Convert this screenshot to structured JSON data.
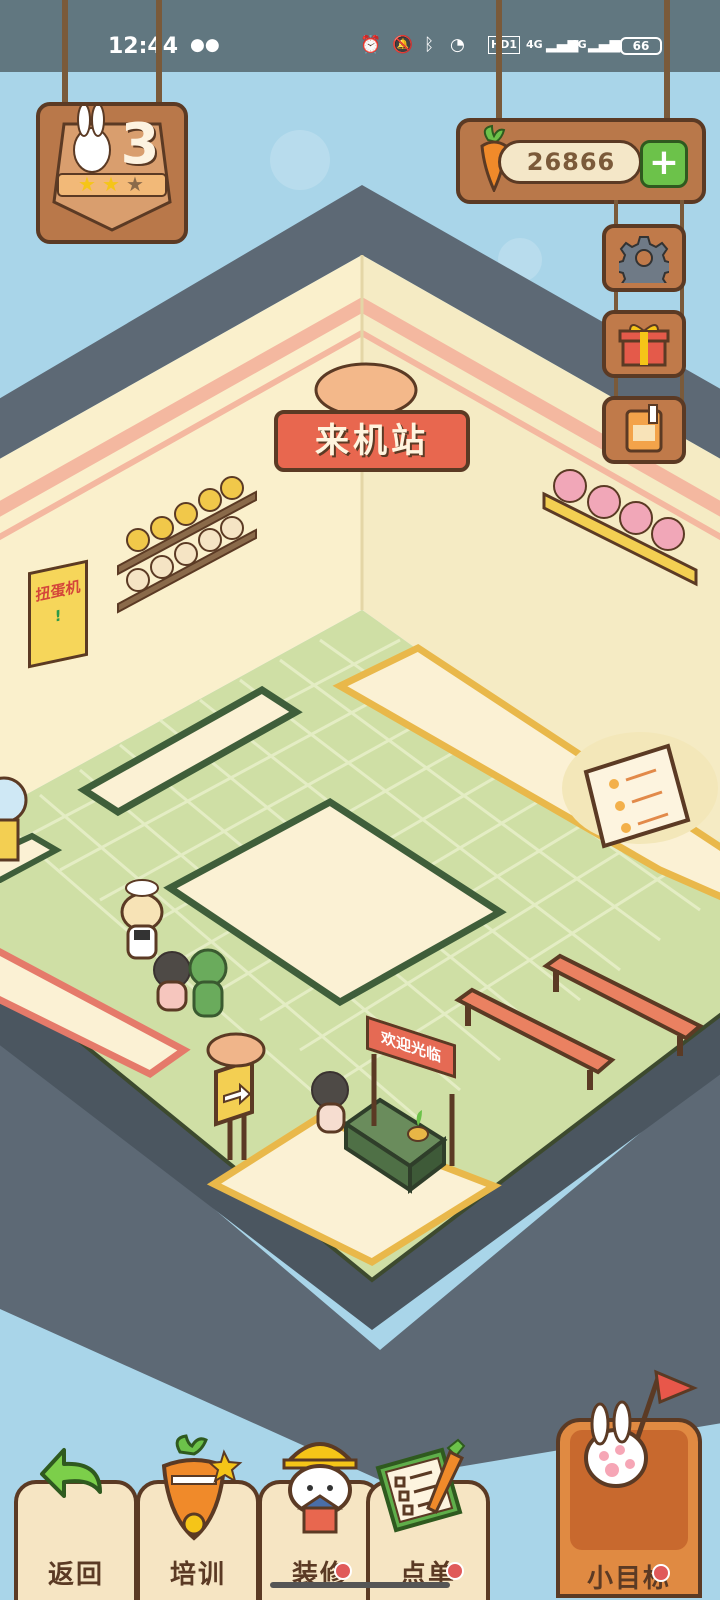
{
  "status_bar": {
    "time": "12:44",
    "icons": [
      "wechat-icon",
      "alarm-icon",
      "mute-icon",
      "bluetooth-icon",
      "wifi-icon",
      "hd-icon",
      "signal-4g-icon",
      "signal-4g-icon"
    ],
    "hd_label": "HD1",
    "net1": "4G",
    "net2": "4G",
    "battery": "66"
  },
  "hud": {
    "level": "3",
    "stars_filled": 2,
    "stars_total": 3,
    "carrots": "26866",
    "add_label": "+"
  },
  "scene": {
    "shop_sign": "来机站",
    "poster_line1": "扭蛋机",
    "poster_line2": "!",
    "welcome_sign": "欢迎光临"
  },
  "side_buttons": [
    "gear-icon",
    "gift-icon",
    "renovation-book-icon"
  ],
  "bottom_nav": {
    "back": "返回",
    "train": "培训",
    "renovate": "装修",
    "order": "点单",
    "goal": "小目标"
  },
  "colors": {
    "sky": "#a9d5e9",
    "floor": "#cfdfa5",
    "wall": "#faf0cc",
    "wood": "#b9784a",
    "outline": "#5b3a24",
    "accent_red": "#e8674f",
    "accent_green": "#6cc24a"
  }
}
